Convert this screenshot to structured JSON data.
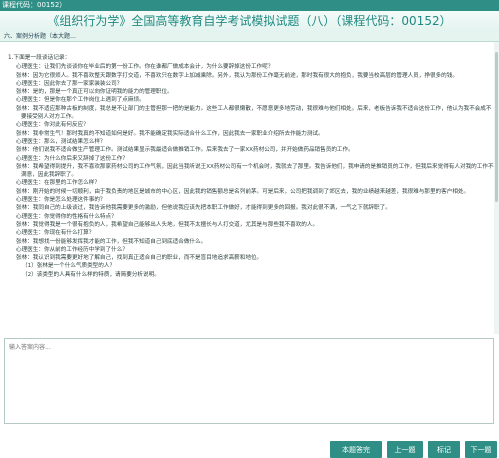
{
  "window": {
    "title": "课程代码：00152）"
  },
  "header": {
    "title": "《组织行为学》全国高等教育自学考试模拟试题（八）（课程代码：00152）"
  },
  "subbar": {
    "label": "六、案例分析题（本大题…"
  },
  "question": {
    "intro": "1.下面是一段谈话记录：",
    "lines": [
      "心理医生：让我们先谈谈你在毕业后的第一份工作。你在谁都厂做成本会计，为什么要辞掉这份工作呢？",
      "张林：因为它很烦人。我不喜欢整天跟数字打交道，不喜欢只在数字上加减乘除。另外，我认为那份工作毫无前途，那时我有很大的抱负，我要当校高层的管理人员，挣很多的钱。",
      "心理医生：因此你去了那一家家装装公司？",
      "张林：是的，那是一个真正可以向你证明我的能力的管理职位。",
      "心理医生：但是你在那个工作岗位上遇到了点麻烦。",
      "张林：我不适应那种古板的制度，我总是不让部门的主管担那一把的是能力。这些工人都很懒散，不愿意更多地劳动，我很难与他们相处。后来，老板告诉我不适合这份工作，他认为我不会成不要接受别人对方工作。",
      "心理医生：你对此有何反应？",
      "张林：我非常生气！那时我真的不知道如何是好。我不能确定我实际适合什么工作，因此我去一家职业介绍所去作能力测试。",
      "心理医生：那么，测试结果怎么样？",
      "张林：他们说我不适合做生产管理工作。测试结果显示我最适合做推销工作。后来我去了一家XX药材公司，并开始做药品销售员的工作。",
      "心理医生：为什么你后来又辞掉了这份工作？",
      "张林：我希望得到提升，我不喜欢那家药材公司的工作气氛，因此当我听说王XX药材公司有一个机会时，我就去了那里。我告诉他们，我申请的是推销员的工作，但我后来觉得有人对我的工作不满意，因此我辞职了。",
      "心理医生：在那里的工作怎么样？",
      "张林：刚开始的时候一切顺利，由于我负责的地区是城市的中心区，因此我的销售额总是名列前茅。可是后来，公司把我调到了郊区去，我的业绩越来越差，我很难与那里的客户相处。",
      "心理医生：你是怎么处理这件事的？",
      "张林：我同自己的上级谈过，我告诉他我需要更多的激励，但他说我应该先把本职工作做好，才能得到更多的回报。我对此很不满，一气之下就辞职了。",
      "心理医生：你觉得你的性格有什么特点？",
      "张林：我觉得我是一个很有抱负的人，我希望自己能够出人头地，但我不太擅长与人打交道，尤其是与那些我不喜欢的人。",
      "心理医生：你现在有什么打算？",
      "张林：我想找一份能够发挥我才能的工作，但我不知道自己到底适合做什么。",
      "心理医生：你从前的工作经历中学到了什么？",
      "张林：我认识到我需要更好地了解自己，找到真正适合自己的职业，而不是盲目地追求高薪和地位。"
    ],
    "subquestions": [
      "（1）张林是一个什么气质类型的人？",
      "（2）该类型的人具有什么样的特质，请简要分析说明。"
    ]
  },
  "answer": {
    "placeholder": "输入答案内容..."
  },
  "buttons": {
    "submit": "本题答完",
    "prev": "上一题",
    "mark": "标记",
    "next": "下一题"
  },
  "colors": {
    "accent": "#2f8f86",
    "title_text": "#1f8a80"
  }
}
